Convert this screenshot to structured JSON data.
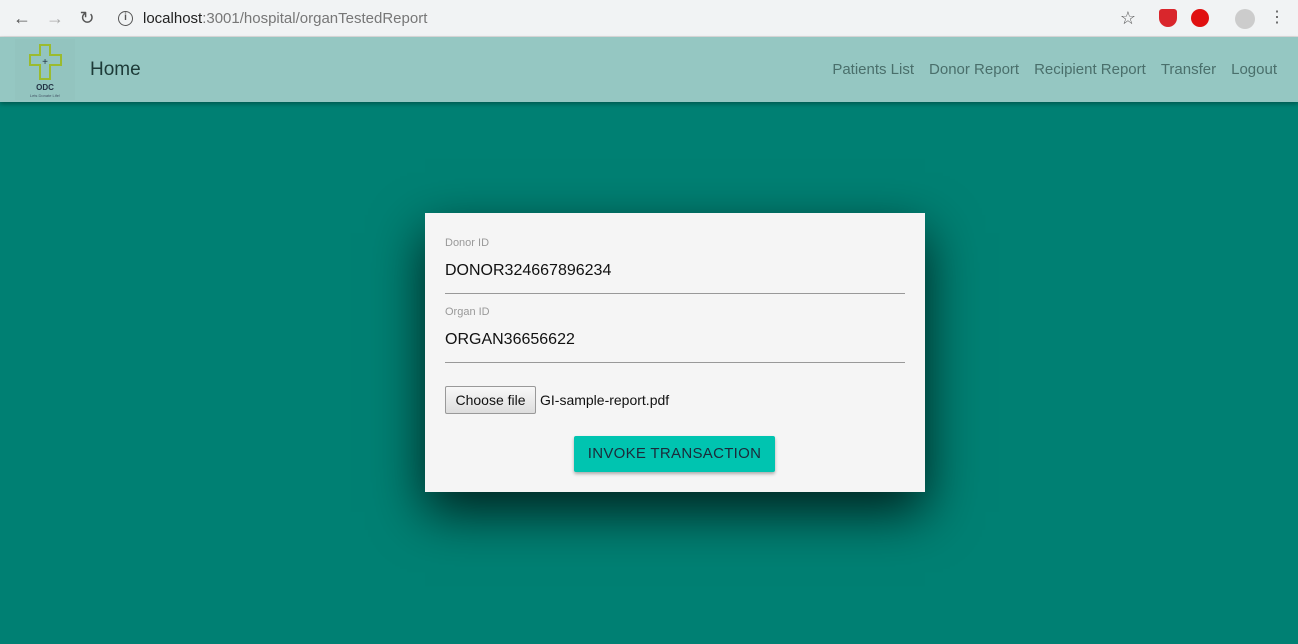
{
  "browser": {
    "url_host": "localhost",
    "url_path": ":3001/hospital/organTestedReport",
    "icons": [
      "back-icon",
      "forward-icon",
      "reload-icon",
      "info-icon",
      "star-icon",
      "shield-icon",
      "stop-hand-icon",
      "profile-icon",
      "menu-icon"
    ]
  },
  "navbar": {
    "logo_text": "ODC",
    "logo_tagline": "Lets Donate Life!",
    "home": "Home",
    "links": [
      "Patients List",
      "Donor Report",
      "Recipient Report",
      "Transfer",
      "Logout"
    ]
  },
  "form": {
    "donor_label": "Donor ID",
    "donor_value": "DONOR324667896234",
    "organ_label": "Organ ID",
    "organ_value": "ORGAN36656622",
    "file_button": "Choose file",
    "file_name": "GI-sample-report.pdf",
    "submit": "INVOKE TRANSACTION"
  },
  "colors": {
    "background": "#008073",
    "navbar": "#95c7c2",
    "button": "#00c4b0"
  }
}
